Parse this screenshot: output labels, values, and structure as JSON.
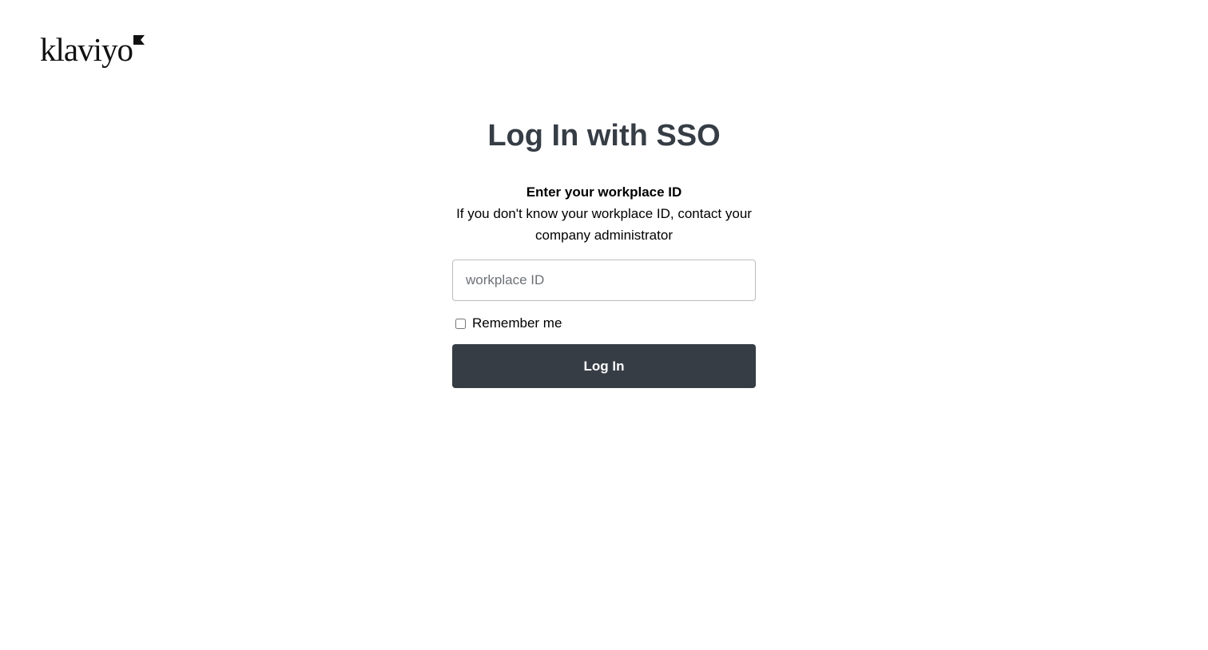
{
  "header": {
    "logo_text": "klaviyo",
    "logo_icon": "flag-icon"
  },
  "main": {
    "title": "Log In with SSO",
    "subtitle_heading": "Enter your workplace ID",
    "subtitle_description": "If you don't know your workplace ID, contact your company administrator",
    "workplace_input": {
      "placeholder": "workplace ID",
      "value": ""
    },
    "remember_me": {
      "label": "Remember me",
      "checked": false
    },
    "login_button_label": "Log In"
  },
  "colors": {
    "title": "#363d45",
    "button_background": "#373d45",
    "button_text": "#ffffff",
    "input_border": "#b9bcc0"
  }
}
